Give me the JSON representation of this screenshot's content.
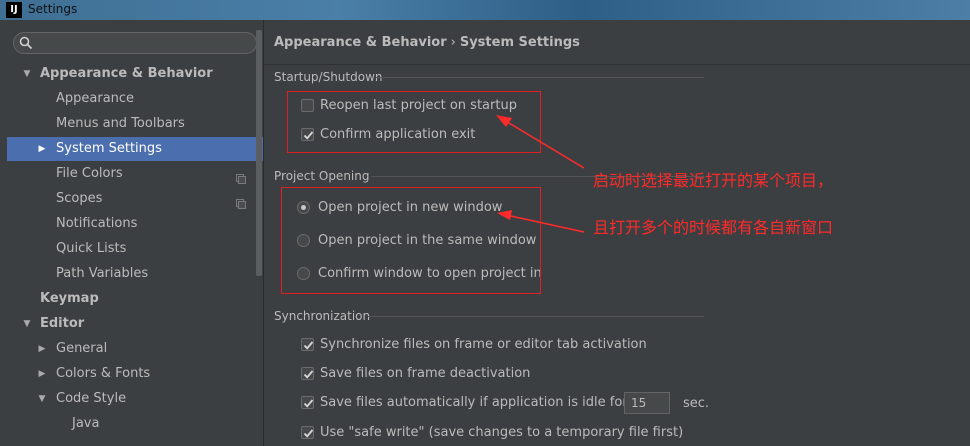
{
  "window": {
    "title": "Settings",
    "logo_text": "IJ"
  },
  "sidebar": {
    "search_placeholder": "",
    "items": [
      {
        "label": "Appearance & Behavior",
        "level": 0,
        "bold": true,
        "arrow": "down"
      },
      {
        "label": "Appearance",
        "level": 1
      },
      {
        "label": "Menus and Toolbars",
        "level": 1
      },
      {
        "label": "System Settings",
        "level": 1,
        "arrow": "right",
        "selected": true
      },
      {
        "label": "File Colors",
        "level": 1,
        "project_icon": true
      },
      {
        "label": "Scopes",
        "level": 1,
        "project_icon": true
      },
      {
        "label": "Notifications",
        "level": 1
      },
      {
        "label": "Quick Lists",
        "level": 1
      },
      {
        "label": "Path Variables",
        "level": 1
      },
      {
        "label": "Keymap",
        "level": 0,
        "bold": true
      },
      {
        "label": "Editor",
        "level": 0,
        "bold": true,
        "arrow": "down"
      },
      {
        "label": "General",
        "level": 1,
        "arrow": "right"
      },
      {
        "label": "Colors & Fonts",
        "level": 1,
        "arrow": "right"
      },
      {
        "label": "Code Style",
        "level": 1,
        "arrow": "down"
      },
      {
        "label": "Java",
        "level": 2
      }
    ]
  },
  "breadcrumb": {
    "parent": "Appearance & Behavior",
    "separator": "›",
    "current": "System Settings"
  },
  "startup": {
    "title": "Startup/Shutdown",
    "reopen_label": "Reopen last project on startup",
    "reopen_checked": false,
    "confirm_exit_label": "Confirm application exit",
    "confirm_exit_checked": true
  },
  "project_opening": {
    "title": "Project Opening",
    "options": [
      {
        "label": "Open project in new window",
        "selected": true
      },
      {
        "label": "Open project in the same window",
        "selected": false
      },
      {
        "label": "Confirm window to open project in",
        "selected": false
      }
    ]
  },
  "sync": {
    "title": "Synchronization",
    "sync_files_label": "Synchronize files on frame or editor tab activation",
    "save_on_deactivation_label": "Save files on frame deactivation",
    "save_idle_label": "Save files automatically if application is idle for",
    "idle_seconds": "15",
    "idle_unit": "sec.",
    "safe_write_label": "Use \"safe write\" (save changes to a temporary file first)"
  },
  "annotations": {
    "line1": "启动时选择最近打开的某个项目，",
    "line2": "且打开多个的时候都有各自新窗口",
    "color": "#ff2a2a"
  },
  "colors": {
    "background": "#3c3f41",
    "selection": "#4b6eaf",
    "text": "#bbbbbb"
  }
}
